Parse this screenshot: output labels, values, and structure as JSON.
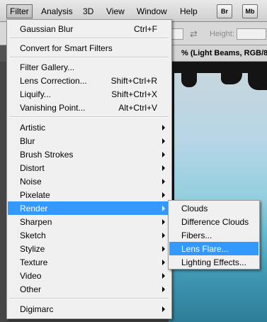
{
  "menubar": {
    "items": [
      "Filter",
      "Analysis",
      "3D",
      "View",
      "Window",
      "Help"
    ],
    "active": "Filter",
    "icons": [
      {
        "name": "bridge-icon",
        "text": "Br"
      },
      {
        "name": "mini-bridge-icon",
        "text": "Mb"
      }
    ]
  },
  "options_bar": {
    "height_label": "Height:",
    "swap_symbol": "⇄"
  },
  "document": {
    "tab_title": "% (Light Beams, RGB/8)"
  },
  "filter_menu": {
    "items": [
      {
        "label": "Gaussian Blur",
        "shortcut": "Ctrl+F"
      },
      {
        "label": "Convert for Smart Filters"
      },
      {
        "label": "Filter Gallery..."
      },
      {
        "label": "Lens Correction...",
        "shortcut": "Shift+Ctrl+R"
      },
      {
        "label": "Liquify...",
        "shortcut": "Shift+Ctrl+X"
      },
      {
        "label": "Vanishing Point...",
        "shortcut": "Alt+Ctrl+V"
      },
      {
        "label": "Artistic",
        "submenu": true
      },
      {
        "label": "Blur",
        "submenu": true
      },
      {
        "label": "Brush Strokes",
        "submenu": true
      },
      {
        "label": "Distort",
        "submenu": true
      },
      {
        "label": "Noise",
        "submenu": true
      },
      {
        "label": "Pixelate",
        "submenu": true
      },
      {
        "label": "Render",
        "submenu": true,
        "highlighted": true
      },
      {
        "label": "Sharpen",
        "submenu": true
      },
      {
        "label": "Sketch",
        "submenu": true
      },
      {
        "label": "Stylize",
        "submenu": true
      },
      {
        "label": "Texture",
        "submenu": true
      },
      {
        "label": "Video",
        "submenu": true
      },
      {
        "label": "Other",
        "submenu": true
      },
      {
        "label": "Digimarc",
        "submenu": true
      }
    ]
  },
  "render_submenu": {
    "items": [
      {
        "label": "Clouds"
      },
      {
        "label": "Difference Clouds"
      },
      {
        "label": "Fibers..."
      },
      {
        "label": "Lens Flare...",
        "highlighted": true
      },
      {
        "label": "Lighting Effects..."
      }
    ]
  },
  "colors": {
    "highlight": "#3399ff",
    "menu_bg": "#f0f0f0"
  }
}
